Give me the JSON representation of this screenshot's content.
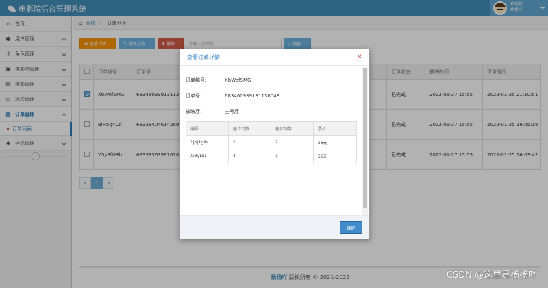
{
  "app": {
    "title": "电影院后台管理系统"
  },
  "user": {
    "welcome": "欢迎您,",
    "name": "杨杨吖"
  },
  "sidebar": {
    "items": [
      {
        "label": "首页",
        "icon": "home-icon"
      },
      {
        "label": "用户管理",
        "icon": "user-icon"
      },
      {
        "label": "角色管理",
        "icon": "key-icon"
      },
      {
        "label": "电影院管理",
        "icon": "building-icon"
      },
      {
        "label": "电影管理",
        "icon": "film-icon"
      },
      {
        "label": "场次管理",
        "icon": "desktop-icon"
      },
      {
        "label": "订单管理",
        "icon": "ticket-icon"
      },
      {
        "label": "评论管理",
        "icon": "comment-icon"
      }
    ],
    "subitem": {
      "label": "订单列表"
    }
  },
  "breadcrumb": {
    "home": "系统",
    "sep": "〉",
    "current": "订单列表"
  },
  "toolbar": {
    "detail": "查看详情",
    "status": "修改状态",
    "delete": "删除",
    "search_placeholder": "请输入订单号...",
    "search": "搜索"
  },
  "table": {
    "headers": [
      "订单编号",
      "订单号",
      "订单状态",
      "放映时间",
      "下单时间"
    ],
    "rows": [
      {
        "code": "XbWofSMG",
        "num": "683460939131138",
        "status": "已完成",
        "show": "2022-01-27 15:55",
        "created": "2022-01-25 21:10:51",
        "checked": true
      },
      {
        "code": "BiH5q4Cd",
        "num": "683384046142894",
        "status": "已完成",
        "show": "2022-01-27 15:55",
        "created": "2022-01-25 16:05:18",
        "checked": false
      },
      {
        "code": "YOyPfORb",
        "num": "683383639916163",
        "status": "已完成",
        "show": "2022-01-27 15:55",
        "created": "2022-01-25 16:03:42",
        "checked": false
      }
    ]
  },
  "pager": {
    "prev": "«",
    "page": "1",
    "next": "»"
  },
  "footer": {
    "name": "杨杨吖",
    "text": " 版权所有 © 2021-2022"
  },
  "watermark": "CSDN @这里是杨杨吖",
  "modal": {
    "title": "查看订单详情",
    "close": "×",
    "fields": [
      {
        "label": "订单编号:",
        "value": "XbWofSMG"
      },
      {
        "label": "订单号:",
        "value": "683460939131138048"
      },
      {
        "label": "放映厅:",
        "value": "三号厅"
      }
    ],
    "seat_headers": [
      "编号",
      "座位行数",
      "座位列数",
      "票价"
    ],
    "seats": [
      {
        "code": "1jNj1gtN",
        "row": "2",
        "col": "2",
        "price": "56元"
      },
      {
        "code": "XiByLii1",
        "row": "4",
        "col": "1",
        "price": "56元"
      }
    ],
    "ok": "确定"
  },
  "colors": {
    "topbar": "#438eb9",
    "accent": "#2b7dbc",
    "orange": "#f89406",
    "danger": "#d15b47"
  }
}
